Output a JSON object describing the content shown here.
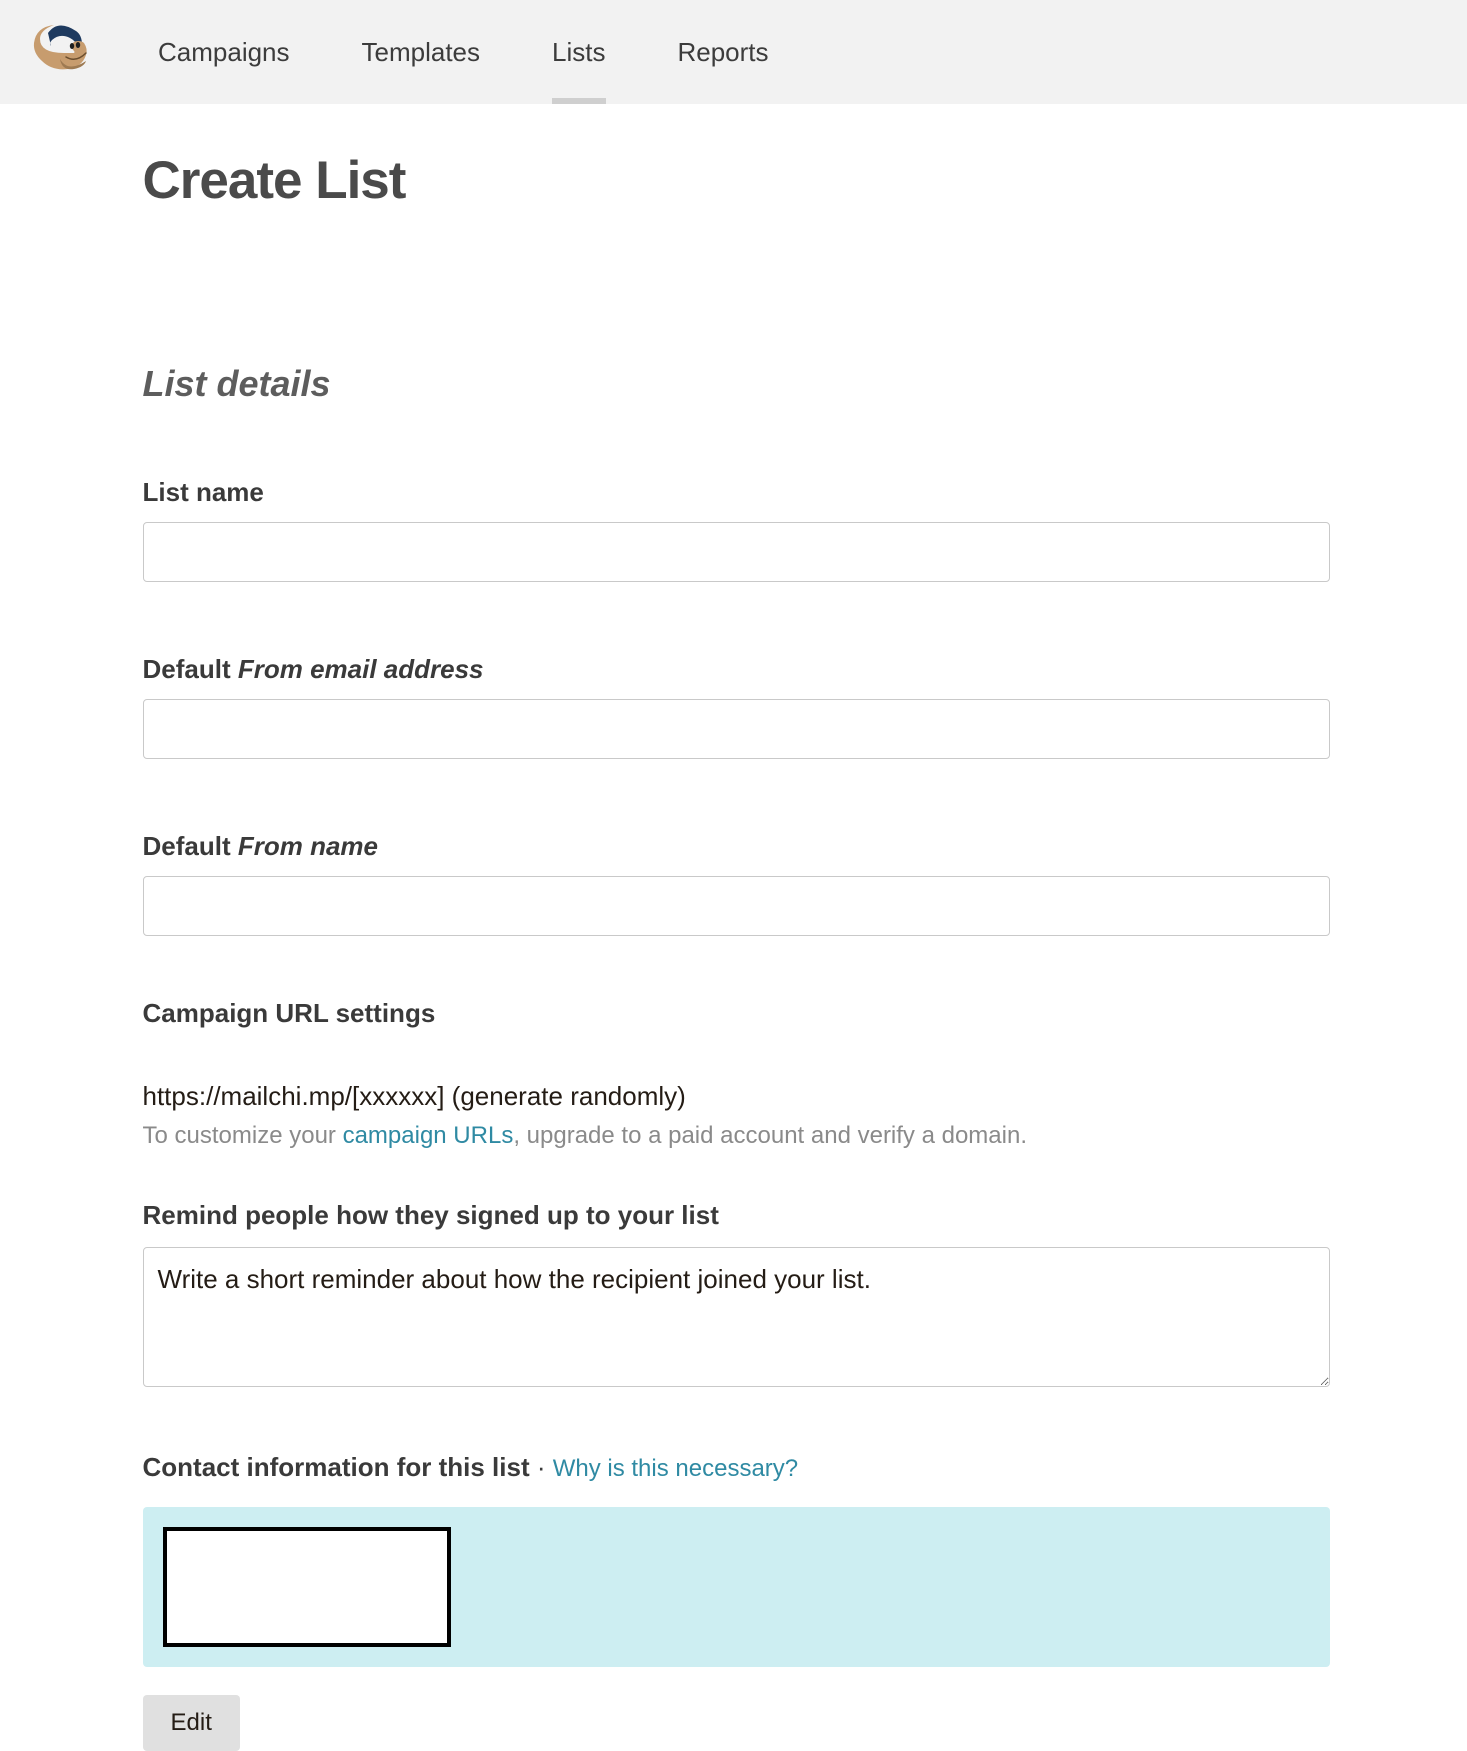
{
  "nav": {
    "campaigns": "Campaigns",
    "templates": "Templates",
    "lists": "Lists",
    "reports": "Reports"
  },
  "pageTitle": "Create List",
  "sectionTitle": "List details",
  "labels": {
    "listName": "List name",
    "defaultFromEmail_prefix": "Default ",
    "defaultFromEmail_ital": "From email address",
    "defaultFromName_prefix": "Default ",
    "defaultFromName_ital": "From name",
    "campaignURL": "Campaign URL settings",
    "remind": "Remind people how they signed up to your list",
    "contact": "Contact information for this list",
    "contactDot": " · ",
    "whyLink": "Why is this necessary?",
    "editBtn": "Edit"
  },
  "values": {
    "listName": "",
    "fromEmail": "",
    "fromName": "",
    "urlValue": "https://mailchi.mp/[xxxxxx] (generate randomly)",
    "reminder": "Write a short reminder about how the recipient joined your list."
  },
  "hint": {
    "pre": "To customize your ",
    "link": "campaign URLs",
    "post": ", upgrade to a paid account and verify a domain."
  }
}
